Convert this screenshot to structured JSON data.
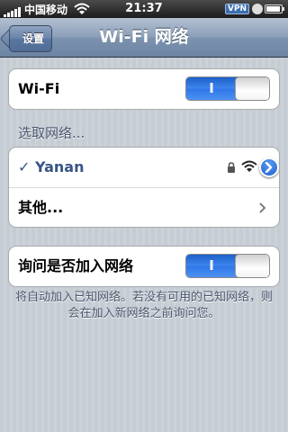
{
  "status_bar": {
    "carrier": "中国移动",
    "time": "21:37",
    "vpn": "VPN",
    "battery_level": 0.95
  },
  "nav": {
    "back_label": "设置",
    "title": "Wi-Fi 网络"
  },
  "wifi_toggle": {
    "label": "Wi-Fi",
    "state_text": "I"
  },
  "network_section": {
    "header": "选取网络...",
    "connected": {
      "checkmark": "✓",
      "name": "Yanan",
      "secured": true
    },
    "other_label": "其他..."
  },
  "ask_toggle": {
    "label": "询问是否加入网络",
    "state_text": "I"
  },
  "footer": {
    "text": "将自动加入已知网络。若没有可用的已知网络，则会在加入新网络之前询问您。"
  },
  "colors": {
    "accent_blue": "#3f87f0",
    "checked_text": "#385487",
    "section_text": "#4c566c"
  }
}
